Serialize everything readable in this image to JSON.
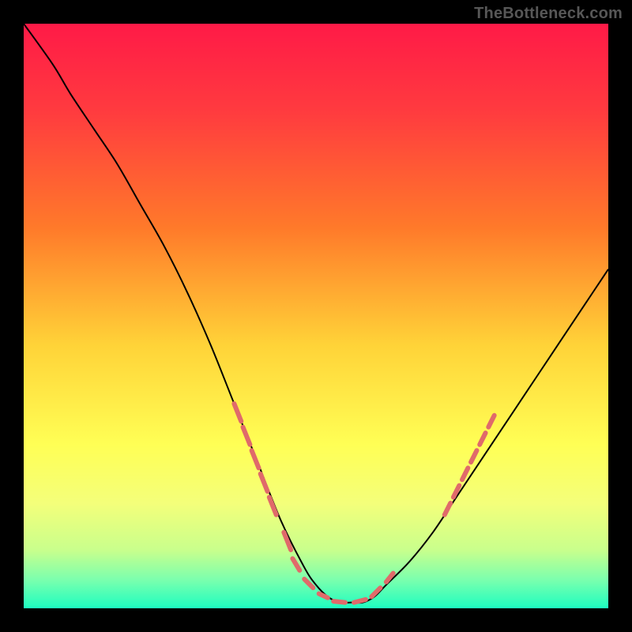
{
  "watermark": "TheBottleneck.com",
  "chart_data": {
    "type": "line",
    "title": "",
    "xlabel": "",
    "ylabel": "",
    "xlim": [
      0,
      100
    ],
    "ylim": [
      0,
      100
    ],
    "grid": false,
    "background": {
      "type": "vertical-gradient",
      "stops": [
        {
          "offset": 0.0,
          "color": "#ff1a47"
        },
        {
          "offset": 0.15,
          "color": "#ff3b3f"
        },
        {
          "offset": 0.35,
          "color": "#ff7a2a"
        },
        {
          "offset": 0.55,
          "color": "#ffd338"
        },
        {
          "offset": 0.72,
          "color": "#ffff55"
        },
        {
          "offset": 0.82,
          "color": "#f4ff7a"
        },
        {
          "offset": 0.9,
          "color": "#c9ff8c"
        },
        {
          "offset": 0.95,
          "color": "#7dffad"
        },
        {
          "offset": 1.0,
          "color": "#1dfec0"
        }
      ]
    },
    "series": [
      {
        "name": "curve",
        "color": "#000000",
        "width": 2,
        "x": [
          0,
          5,
          8,
          12,
          16,
          20,
          24,
          28,
          32,
          36,
          40,
          44,
          48,
          50,
          52,
          54,
          56,
          58,
          60,
          62,
          66,
          70,
          74,
          76,
          80,
          84,
          88,
          92,
          96,
          100
        ],
        "y": [
          100,
          93,
          88,
          82,
          76,
          69,
          62,
          54,
          45,
          35,
          25,
          15,
          7,
          4,
          2,
          1,
          1,
          1,
          2,
          4,
          8,
          13,
          19,
          22,
          28,
          34,
          40,
          46,
          52,
          58
        ]
      },
      {
        "name": "marker-dashes",
        "color": "#e06a6a",
        "width": 6,
        "segments": [
          {
            "x1": 36,
            "y1": 35,
            "x2": 37.2,
            "y2": 32
          },
          {
            "x1": 37.5,
            "y1": 31,
            "x2": 38.7,
            "y2": 28
          },
          {
            "x1": 39.0,
            "y1": 27,
            "x2": 40.2,
            "y2": 24
          },
          {
            "x1": 40.5,
            "y1": 23,
            "x2": 41.7,
            "y2": 20
          },
          {
            "x1": 42.0,
            "y1": 19,
            "x2": 43.2,
            "y2": 16
          },
          {
            "x1": 44.5,
            "y1": 13,
            "x2": 45.7,
            "y2": 10
          },
          {
            "x1": 46.0,
            "y1": 8.5,
            "x2": 47.2,
            "y2": 6.5
          },
          {
            "x1": 48.0,
            "y1": 5.0,
            "x2": 49.5,
            "y2": 3.5
          },
          {
            "x1": 50.5,
            "y1": 2.5,
            "x2": 52.0,
            "y2": 1.8
          },
          {
            "x1": 53.0,
            "y1": 1.2,
            "x2": 55.0,
            "y2": 1.0
          },
          {
            "x1": 56.5,
            "y1": 1.0,
            "x2": 58.5,
            "y2": 1.5
          },
          {
            "x1": 59.5,
            "y1": 2.0,
            "x2": 61.0,
            "y2": 3.5
          },
          {
            "x1": 62.0,
            "y1": 4.5,
            "x2": 63.2,
            "y2": 6.0
          },
          {
            "x1": 72.0,
            "y1": 16.0,
            "x2": 73.0,
            "y2": 18.0
          },
          {
            "x1": 73.5,
            "y1": 19.0,
            "x2": 74.5,
            "y2": 21.0
          },
          {
            "x1": 75.0,
            "y1": 22.0,
            "x2": 76.0,
            "y2": 24.0
          },
          {
            "x1": 76.5,
            "y1": 25.0,
            "x2": 77.5,
            "y2": 27.0
          },
          {
            "x1": 78.0,
            "y1": 28.0,
            "x2": 79.0,
            "y2": 30.0
          },
          {
            "x1": 79.5,
            "y1": 31.0,
            "x2": 80.5,
            "y2": 33.0
          }
        ]
      }
    ]
  }
}
